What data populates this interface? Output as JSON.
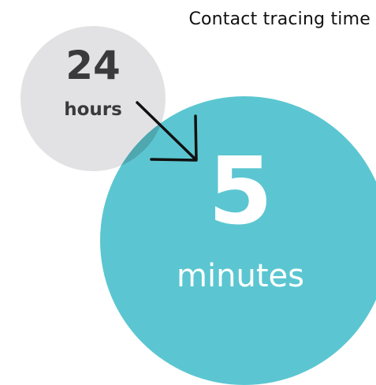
{
  "title": "Contact tracing time",
  "before": {
    "value": "24",
    "unit": "hours"
  },
  "after": {
    "value": "5",
    "unit": "minutes"
  },
  "colors": {
    "before_circle": "#e2e2e4",
    "after_circle": "#5bc6d1",
    "overlap": "#4fa7b0",
    "before_text": "#3a3a3c",
    "after_text": "#ffffff",
    "arrow": "#111111"
  },
  "icons": {
    "transition": "arrow-down-right-icon"
  }
}
